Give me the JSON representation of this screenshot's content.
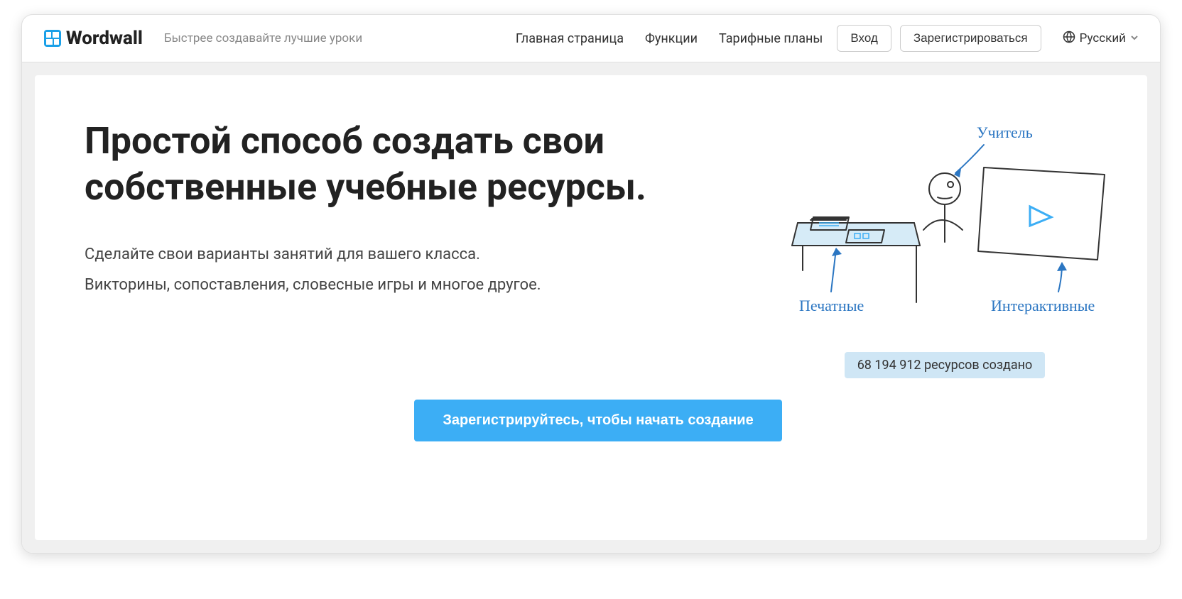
{
  "header": {
    "logo_text": "Wordwall",
    "tagline": "Быстрее создавайте лучшие уроки",
    "nav": {
      "home": "Главная страница",
      "features": "Функции",
      "pricing": "Тарифные планы"
    },
    "login": "Вход",
    "register": "Зарегистрироваться",
    "language": "Русский"
  },
  "hero": {
    "title": "Простой способ создать свои собственные учебные ресурсы.",
    "subtext1": "Сделайте свои варианты занятий для вашего класса.",
    "subtext2": "Викторины, сопоставления, словесные игры и многое другое.",
    "illustration": {
      "teacher": "Учитель",
      "printables": "Печатные",
      "interactives": "Интерактивные"
    },
    "counter": "68 194 912 ресурсов создано",
    "cta": "Зарегистрируйтесь, чтобы начать создание"
  },
  "colors": {
    "accent_blue": "#3caef5",
    "button_border": "#ccc",
    "badge_bg": "#cfe6f5",
    "cursive_blue": "#2b76c2"
  }
}
